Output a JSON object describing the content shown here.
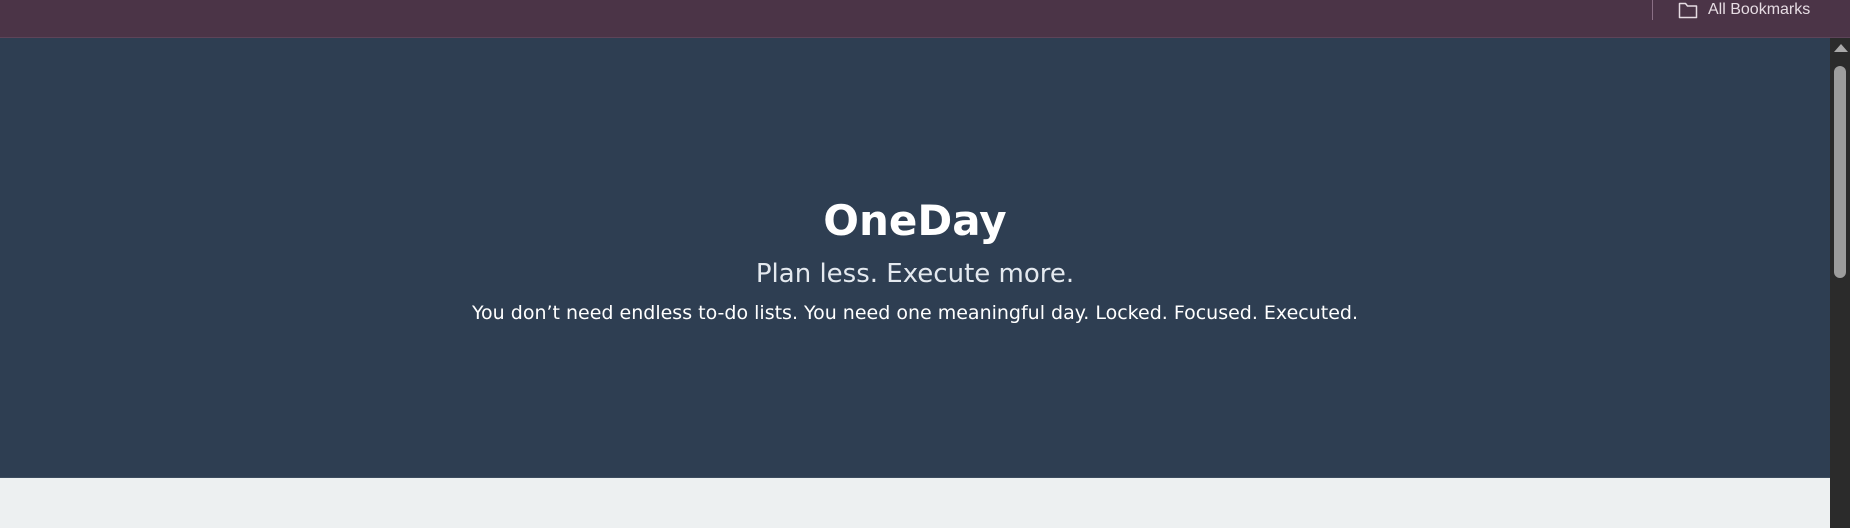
{
  "browser": {
    "bookmarks_label": "All Bookmarks",
    "bookmarks_icon": "folder-icon",
    "colors": {
      "toolbar_bg": "#4b3447",
      "toolbar_text": "#e6dce3"
    }
  },
  "hero": {
    "title": "OneDay",
    "tagline": "Plan less. Execute more.",
    "description": "You don’t need endless to-do lists. You need one meaningful day. Locked. Focused. Executed.",
    "colors": {
      "background": "#2e3e52",
      "text": "#ffffff"
    }
  },
  "page": {
    "colors": {
      "below_hero_bg": "#edf0f1"
    }
  },
  "scrollbar": {
    "up_arrow_icon": "triangle-up-icon"
  }
}
